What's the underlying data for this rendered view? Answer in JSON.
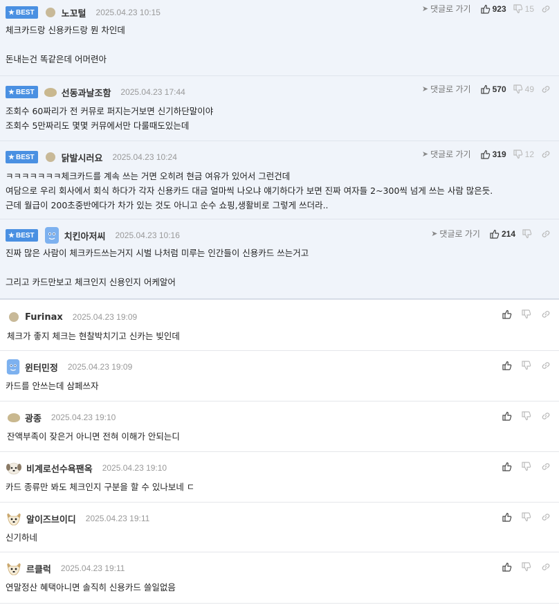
{
  "labels": {
    "best_badge": "BEST",
    "reply_link": "댓글로 가기"
  },
  "colors": {
    "best_bg": "#f0f4fa",
    "badge_bg": "#4a90e2",
    "date": "#999999"
  },
  "best_comments": [
    {
      "nick": "노꼬털",
      "avatar": "beige-blob-avatar",
      "date": "2025.04.23 10:15",
      "up": "923",
      "down": "15",
      "lines": [
        "체크카드랑 신용카드랑 뭔 차인데",
        "",
        "돈내는건 똑같은데 어머련아"
      ]
    },
    {
      "nick": "선동과날조함",
      "avatar": "beige-blob-avatar",
      "date": "2025.04.23 17:44",
      "up": "570",
      "down": "49",
      "lines": [
        "조회수 60짜리가 전 커뮤로 퍼지는거보면 신기하단말이야",
        "조회수 5만짜리도 몇몇 커뮤에서만 다룰때도있는데"
      ]
    },
    {
      "nick": "닭발시러요",
      "avatar": "beige-blob-avatar",
      "date": "2025.04.23 10:24",
      "up": "319",
      "down": "12",
      "lines": [
        "ㅋㅋㅋㅋㅋㅋㅋ체크카드를 계속 쓰는 거면 오히려 현금 여유가 있어서 그런건데",
        "여담으로 우리 회사에서 회식 하다가 각자 신용카드 대금 얼마씩 나오냐 얘기하다가 보면 진짜 여자들 2~300씩 넘게 쓰는 사람 많은듯.",
        "근데 월급이 200초중반에다가 차가 있는 것도 아니고 순수 쇼핑,생활비로 그렇게 쓰더라.."
      ]
    },
    {
      "nick": "치킨아저씨",
      "avatar": "blue-character-avatar",
      "date": "2025.04.23 10:16",
      "up": "214",
      "down": "",
      "lines": [
        "진짜 많은 사람이 체크카드쓰는거지 시벌 나처럼 미루는 인간들이 신용카드 쓰는거고",
        "",
        "그리고 카드만보고 체크인지 신용인지 어케알어"
      ]
    }
  ],
  "comments": [
    {
      "nick": "Furinax",
      "avatar": "beige-blob-avatar",
      "date": "2025.04.23 19:09",
      "text": "체크가 좋지 체크는 현찰박치기고 신카는 빚인데"
    },
    {
      "nick": "윈터민정",
      "avatar": "blue-character-avatar",
      "date": "2025.04.23 19:09",
      "text": "카드를 안쓰는데 삼페쓰자"
    },
    {
      "nick": "광종",
      "avatar": "beige-blob-avatar",
      "date": "2025.04.23 19:10",
      "text": "잔액부족이 잦은거 아니면 전혀 이해가 안되는디"
    },
    {
      "nick": "비계로선수욕팬옥",
      "avatar": "dog-avatar",
      "date": "2025.04.23 19:10",
      "text": "카드 종류만 봐도 체크인지 구분을 할 수 있나보네 ㄷ"
    },
    {
      "nick": "알이즈브이디",
      "avatar": "dog-avatar",
      "date": "2025.04.23 19:11",
      "text": "신기하네"
    },
    {
      "nick": "르클럭",
      "avatar": "dog-avatar",
      "date": "2025.04.23 19:11",
      "text": "연말정산 혜택아니면 솔직히 신용카드 쓸일없음"
    }
  ]
}
